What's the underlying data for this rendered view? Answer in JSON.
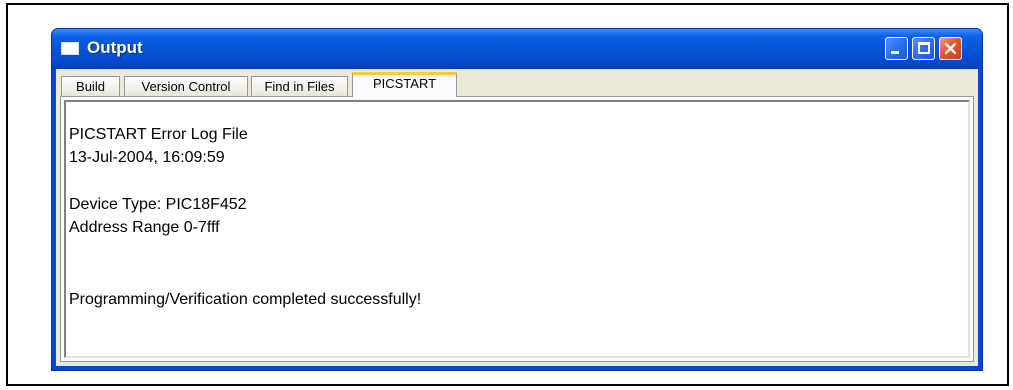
{
  "window": {
    "title": "Output"
  },
  "tabs": [
    {
      "label": "Build"
    },
    {
      "label": "Version Control"
    },
    {
      "label": "Find in Files"
    },
    {
      "label": "PICSTART"
    }
  ],
  "active_tab": "PICSTART",
  "output_lines": {
    "line1": "PICSTART Error Log File",
    "line2": "13-Jul-2004, 16:09:59",
    "line3": "Device Type: PIC18F452",
    "line4": "Address Range 0-7fff",
    "line5": "Programming/Verification completed successfully!"
  },
  "colors": {
    "titlebar": "#0653d6",
    "close_button": "#e2582e",
    "active_tab_accent": "#ffc83c",
    "client_bg": "#ece9d8"
  }
}
